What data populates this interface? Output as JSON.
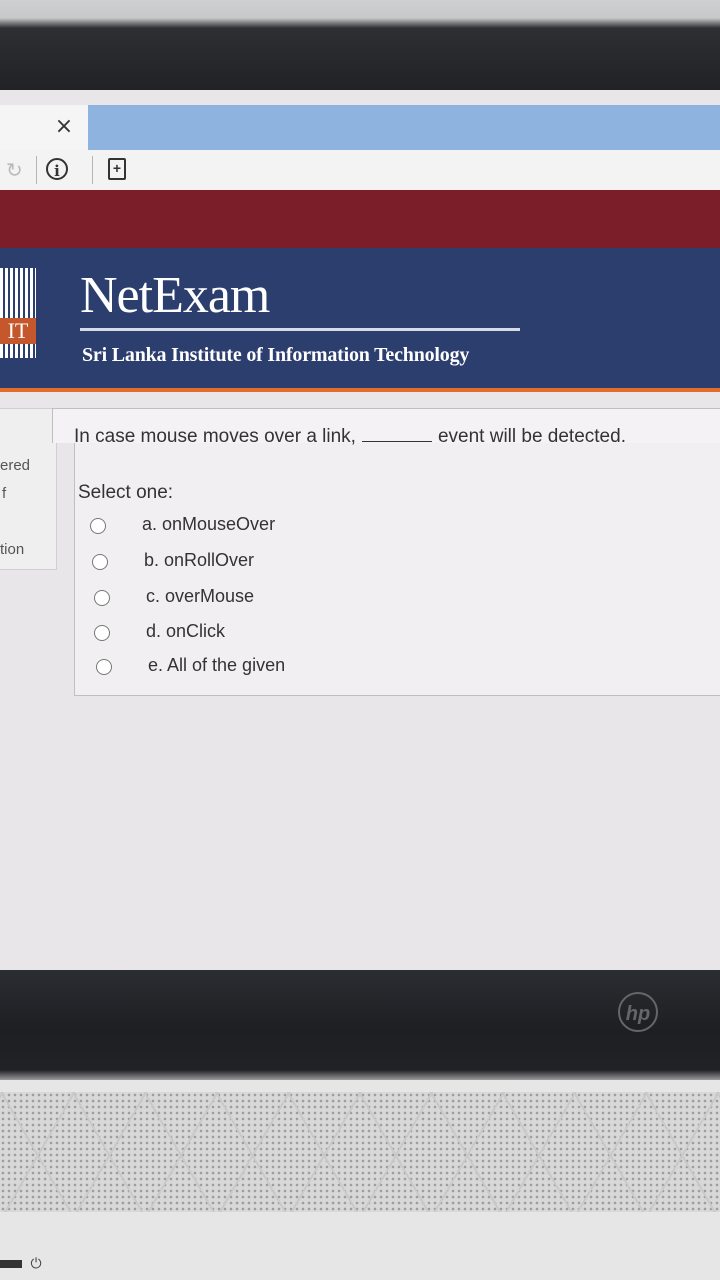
{
  "browser": {
    "close_glyph": "×",
    "reload_glyph": "↻",
    "info_glyph": "i",
    "page_glyph": "+"
  },
  "site": {
    "logo_text": "IT",
    "title": "NetExam",
    "subtitle": "Sri Lanka Institute of Information Technology"
  },
  "sidebar": {
    "line1": "ered",
    "line2": "f",
    "line3": "tion"
  },
  "question": {
    "text_before": "In case mouse moves over a link,",
    "text_after": "event will be detected.",
    "select_label": "Select one:",
    "options": [
      {
        "label": "a. onMouseOver"
      },
      {
        "label": "b. onRollOver"
      },
      {
        "label": "c. overMouse"
      },
      {
        "label": "d. onClick"
      },
      {
        "label": "e. All of the given"
      }
    ]
  },
  "device": {
    "brand": "hp",
    "power_glyph": "⏻"
  },
  "colors": {
    "maroon": "#7b1e2a",
    "header_blue": "#2c3e6e",
    "accent_orange": "#e36b2b",
    "tab_blue": "#8fb3df"
  }
}
